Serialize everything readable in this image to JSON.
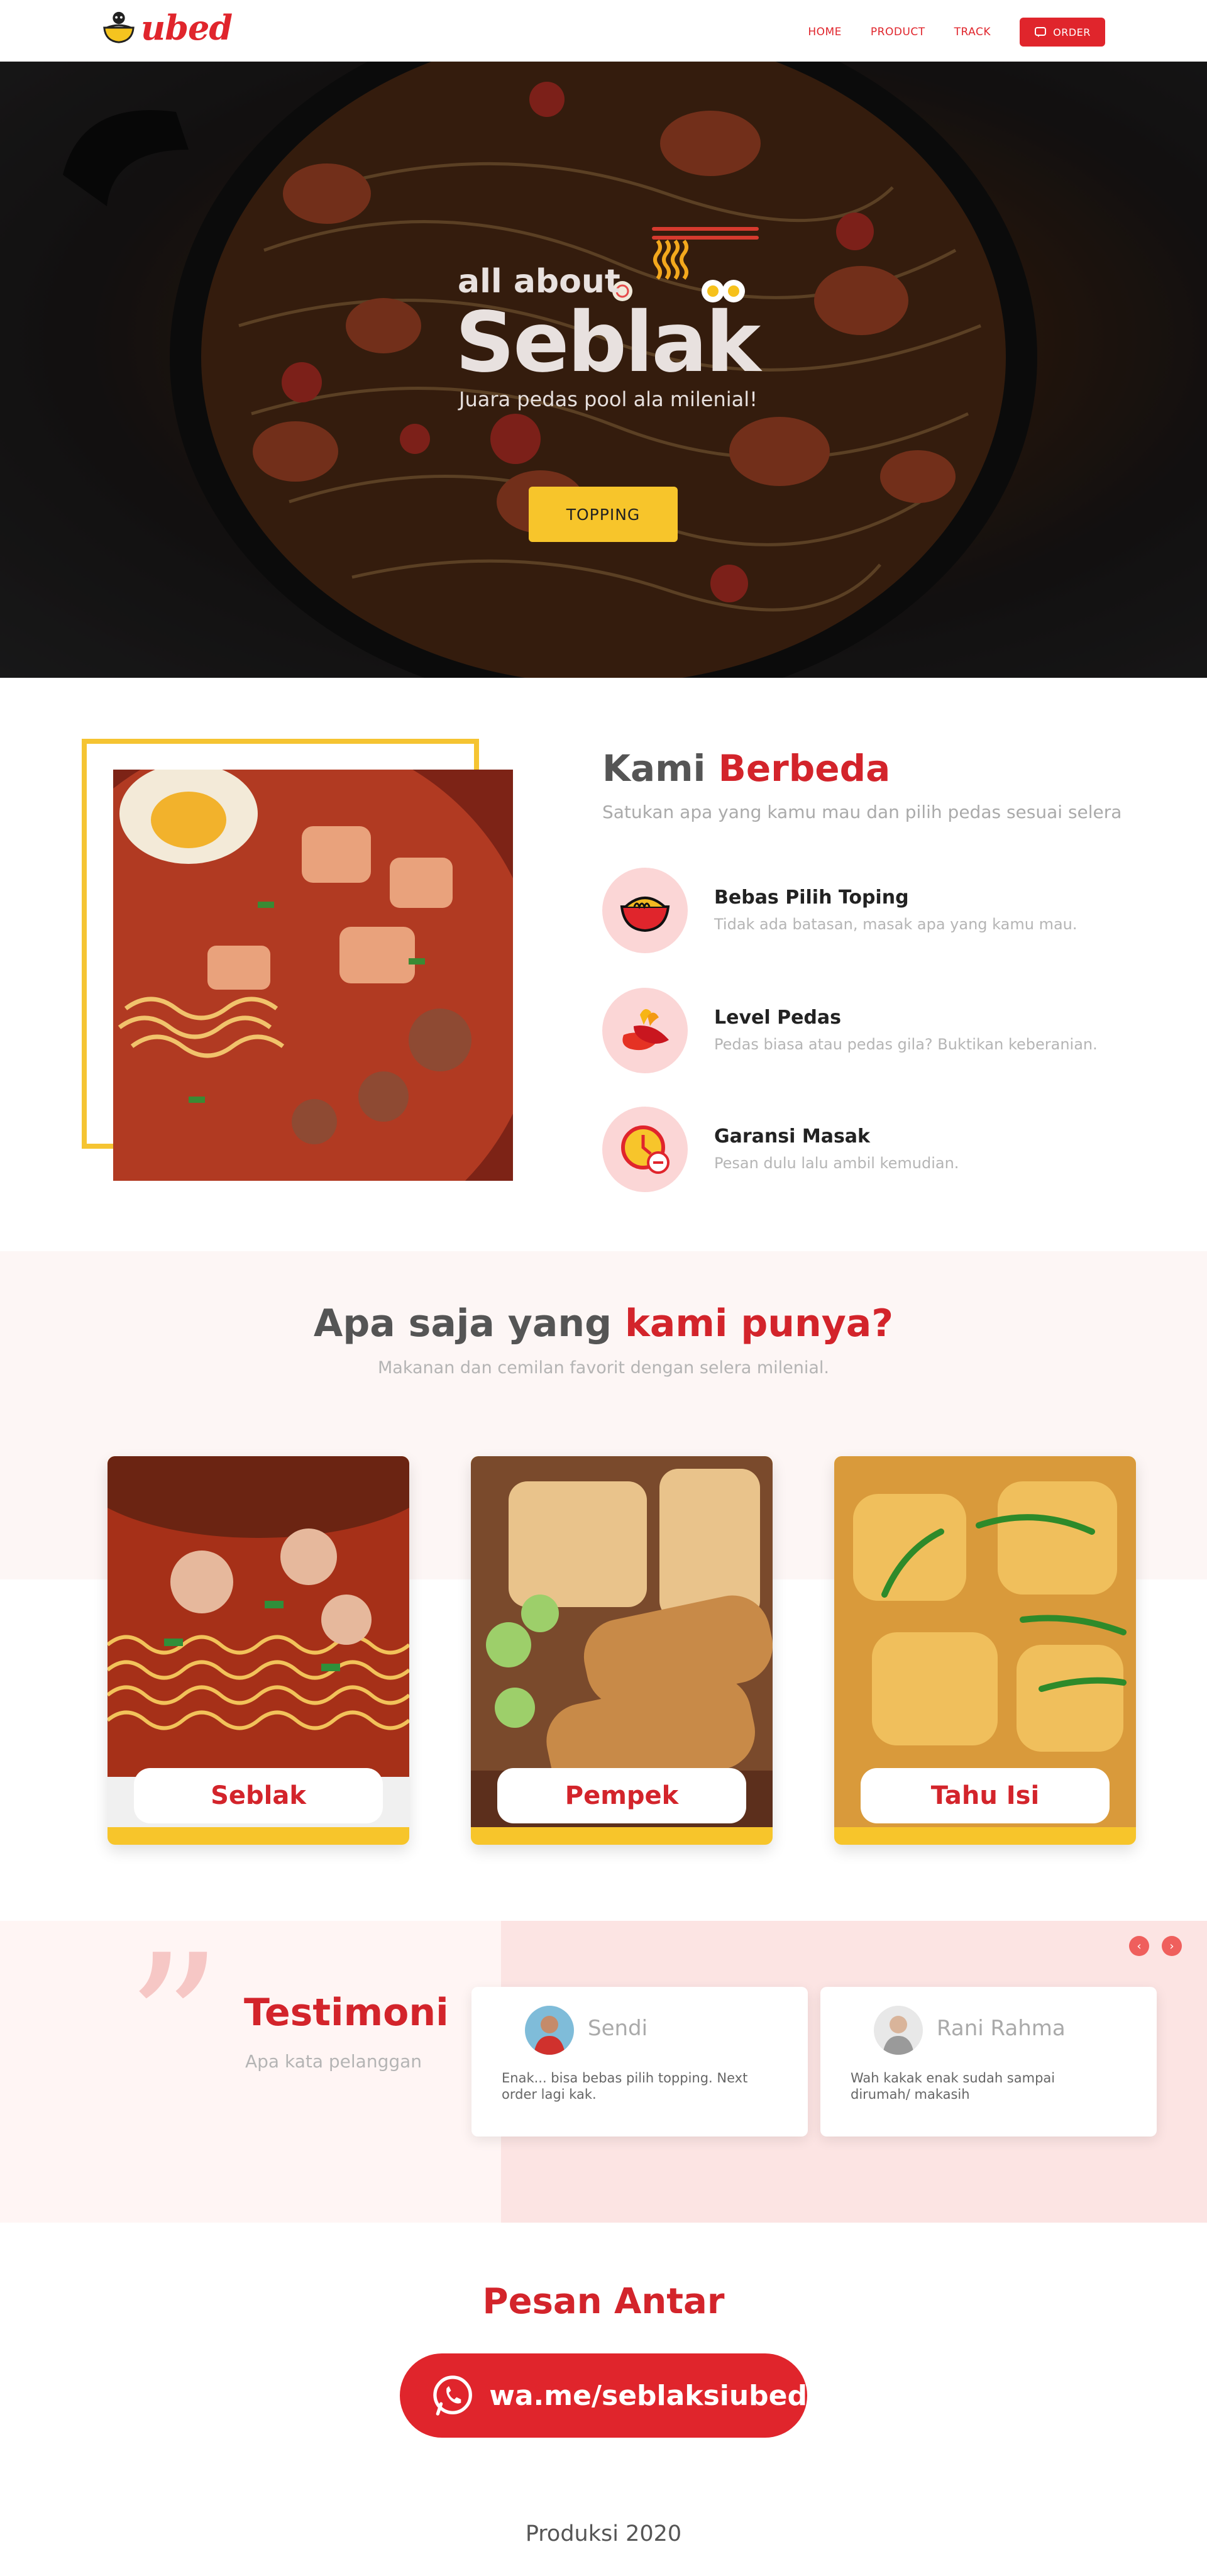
{
  "brand": {
    "name": "ubed"
  },
  "nav": {
    "home": "HOME",
    "product": "PRODUCT",
    "track": "TRACK",
    "order": "ORDER"
  },
  "hero": {
    "line1": "all about",
    "line2": "Seblak",
    "tagline": "Juara pedas pool ala milenial!",
    "cta": "TOPPING"
  },
  "different": {
    "title_plain": "Kami",
    "title_accent": "Berbeda",
    "subtitle": "Satukan apa yang kamu mau dan pilih pedas sesuai selera",
    "features": [
      {
        "title": "Bebas Pilih Toping",
        "desc": "Tidak ada batasan, masak apa yang kamu mau.",
        "icon": "noodle-bowl-icon"
      },
      {
        "title": "Level Pedas",
        "desc": "Pedas biasa atau pedas gila? Buktikan keberanian.",
        "icon": "chili-icon"
      },
      {
        "title": "Garansi Masak",
        "desc": "Pesan dulu lalu ambil kemudian.",
        "icon": "clock-icon"
      }
    ]
  },
  "products": {
    "title_plain": "Apa saja yang",
    "title_accent": "kami punya?",
    "subtitle": "Makanan dan cemilan favorit dengan selera milenial.",
    "items": [
      {
        "label": "Seblak"
      },
      {
        "label": "Pempek"
      },
      {
        "label": "Tahu Isi"
      }
    ]
  },
  "testimonials": {
    "title": "Testimoni",
    "subtitle": "Apa kata pelanggan",
    "items": [
      {
        "name": "Sendi",
        "message": "Enak... bisa bebas pilih topping. Next order lagi kak."
      },
      {
        "name": "Rani Rahma",
        "message": "Wah kakak enak sudah sampai dirumah/ makasih"
      }
    ]
  },
  "order": {
    "title": "Pesan Antar",
    "whatsapp": "wa.me/seblaksiubed"
  },
  "footer": {
    "text": "Produksi 2020"
  },
  "colors": {
    "accent": "#e0252c",
    "yellow": "#f7c52b",
    "pink": "#fce4e3"
  }
}
